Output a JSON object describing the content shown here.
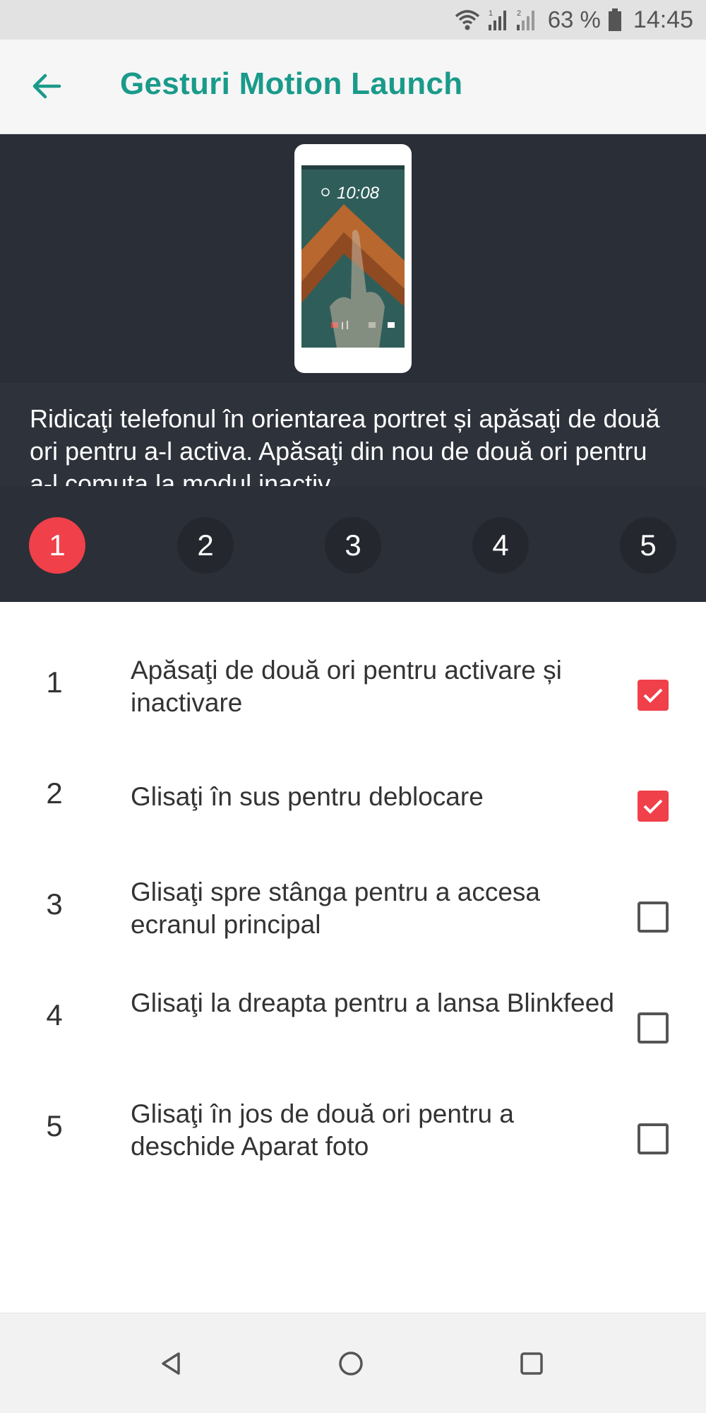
{
  "status_bar": {
    "wifi_icon": "wifi-icon",
    "signal1_icon": "signal-sim1-icon",
    "signal2_icon": "signal-sim2-icon",
    "battery_percent": "63 %",
    "battery_icon": "battery-icon",
    "time": "14:45"
  },
  "app_bar": {
    "back_icon": "arrow-back-icon",
    "title": "Gesturi Motion Launch"
  },
  "demo": {
    "illustration": "phone-double-tap-illustration",
    "phone_clock": "10:08",
    "description": "Ridicaţi telefonul în orientarea portret și apăsaţi de două ori pentru a-l activa. Apăsaţi din nou de două ori pentru a-l comuta la modul inactiv.",
    "steps": [
      "1",
      "2",
      "3",
      "4",
      "5"
    ],
    "active_step": "1"
  },
  "gestures": [
    {
      "number": "1",
      "label": "Apăsaţi de două ori pentru activare și inactivare",
      "checked": true
    },
    {
      "number": "2",
      "label": "Glisaţi în sus pentru deblocare",
      "checked": true
    },
    {
      "number": "3",
      "label": "Glisaţi spre stânga pentru a accesa ecranul principal",
      "checked": false
    },
    {
      "number": "4",
      "label": "Glisaţi la dreapta pentru a lansa Blinkfeed",
      "checked": false
    },
    {
      "number": "5",
      "label": "Glisaţi în jos de două ori pentru a deschide Aparat foto",
      "checked": false
    }
  ],
  "nav_bar": {
    "back_icon": "nav-back-icon",
    "home_icon": "nav-home-icon",
    "recents_icon": "nav-recents-icon"
  },
  "colors": {
    "accent": "#1a9a8a",
    "checkbox_active": "#f0404a",
    "panel_bg": "#2b2f38"
  }
}
